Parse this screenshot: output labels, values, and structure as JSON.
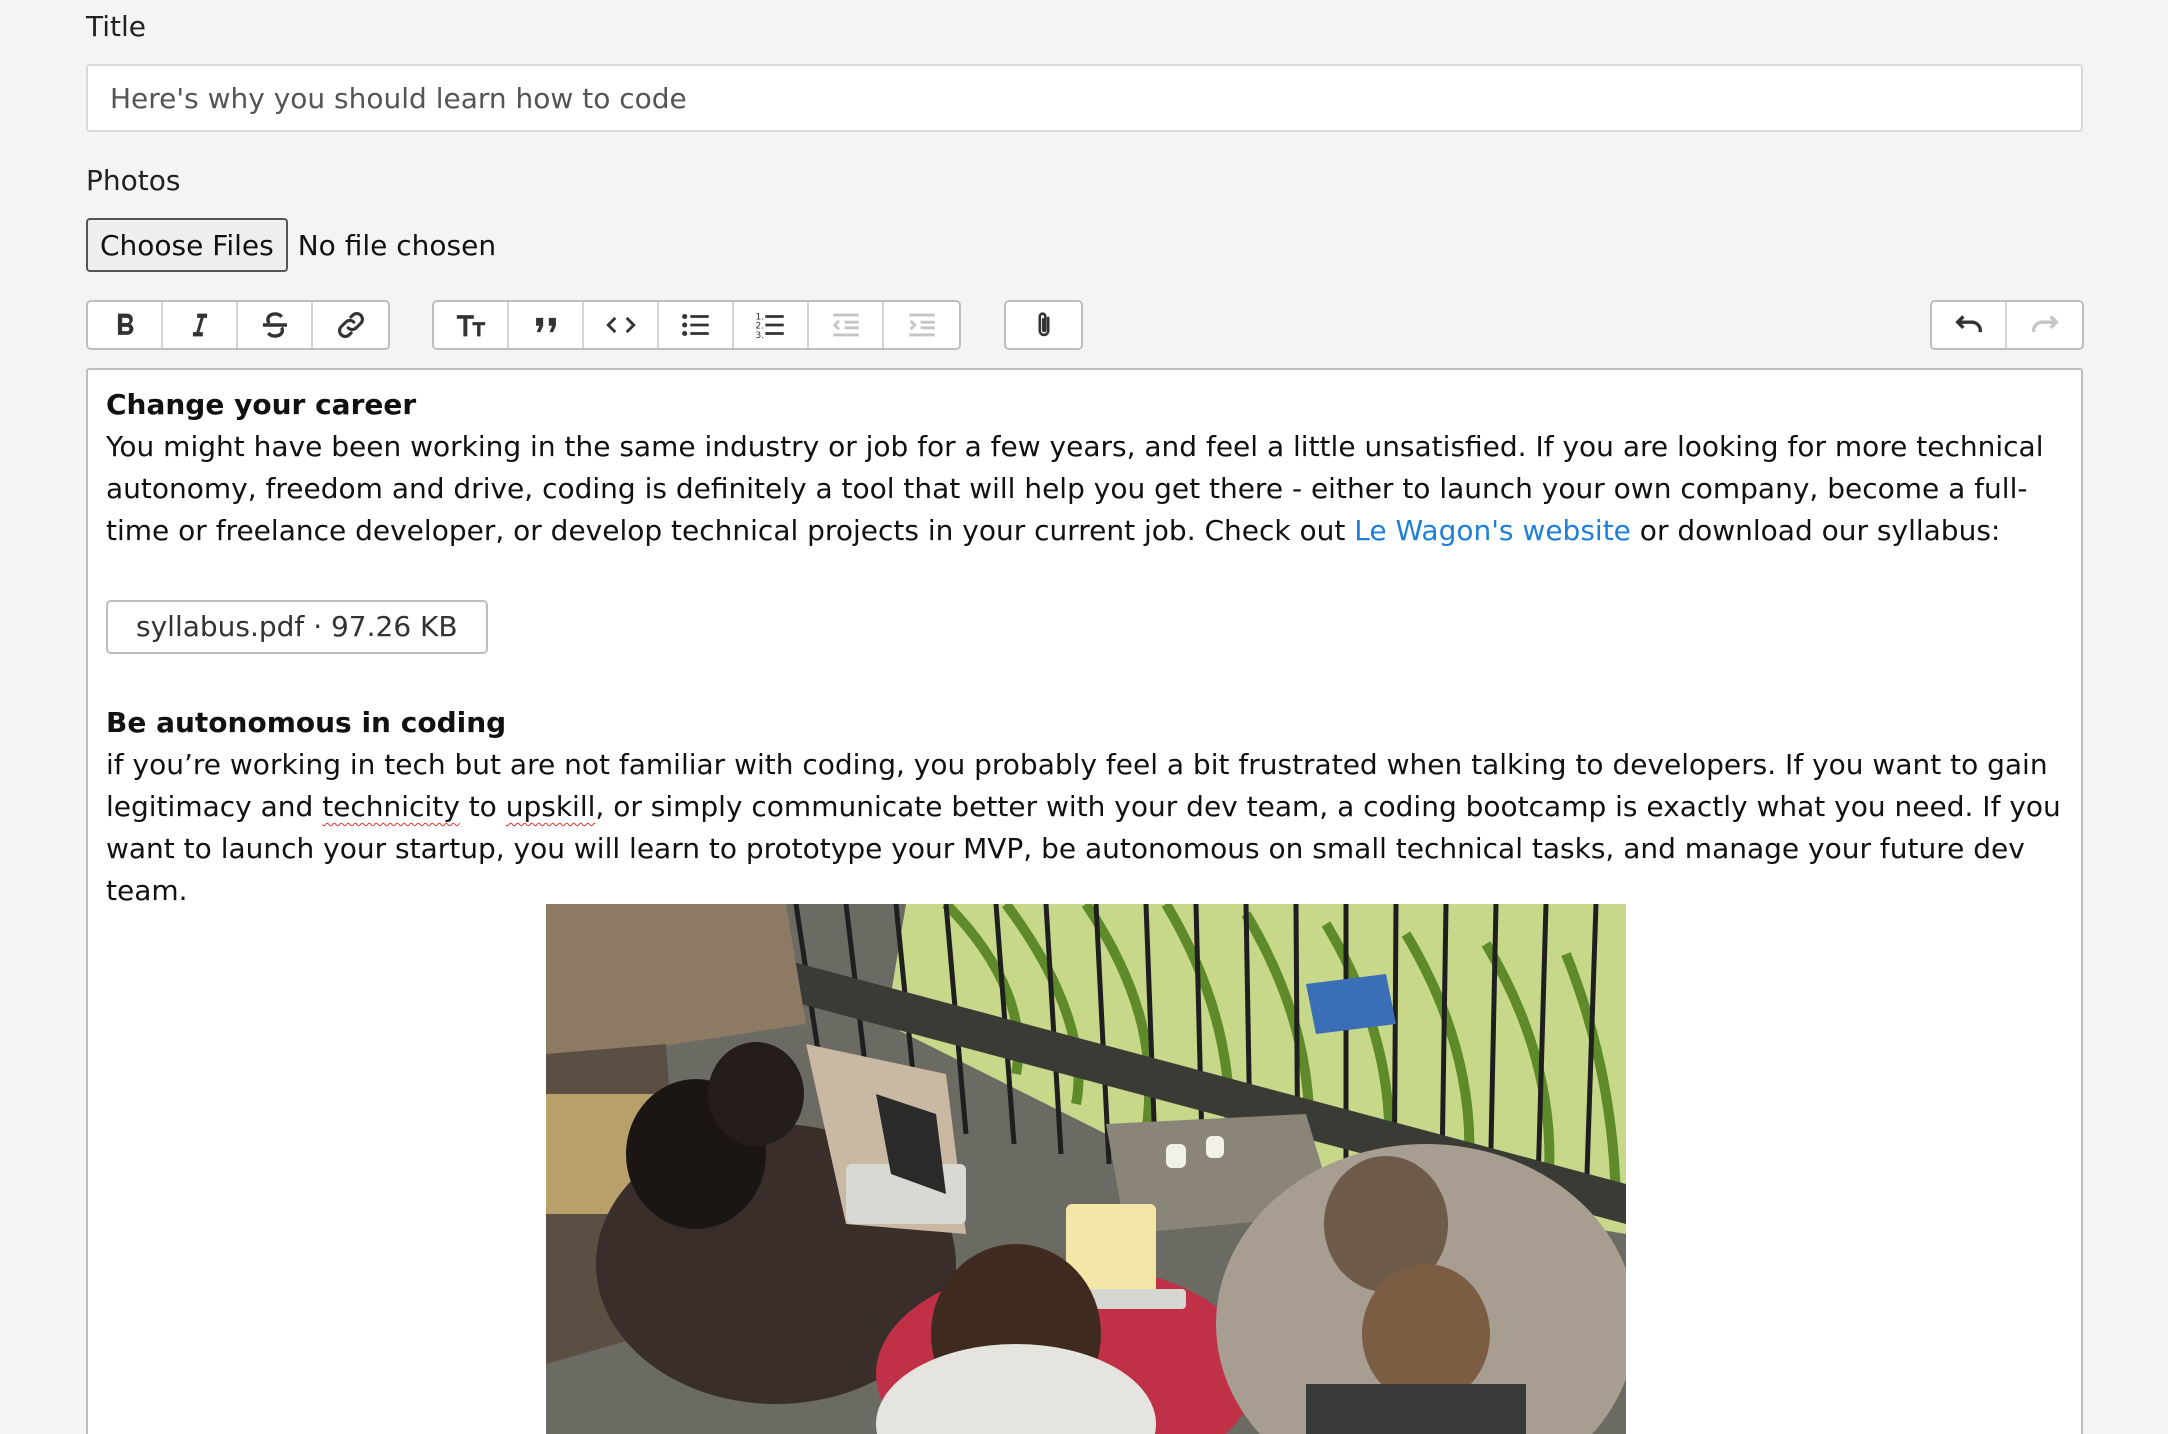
{
  "form": {
    "title_label": "Title",
    "title_value": "Here's why you should learn how to code",
    "photos_label": "Photos",
    "choose_files_label": "Choose Files",
    "no_file_text": "No file chosen"
  },
  "toolbar": {
    "text_tools": [
      "bold-icon",
      "italic-icon",
      "strikethrough-icon",
      "link-icon"
    ],
    "block_tools": [
      "heading-icon",
      "quote-icon",
      "code-icon",
      "bullet-list-icon",
      "numbered-list-icon",
      "decrease-indent-icon",
      "increase-indent-icon"
    ],
    "file_tools": [
      "attach-icon"
    ],
    "history_tools": [
      "undo-icon",
      "redo-icon"
    ]
  },
  "editor": {
    "section1_heading": "Change your career",
    "section1_text_before_link": "You might have been working in the same industry or job for a few years, and feel a little unsatisfied. If you are looking for more technical autonomy, freedom and drive, coding is definitely a tool that will help you get there - either to launch your own company, become a full-time or freelance developer, or develop technical projects in your current job. Check out ",
    "section1_link": "Le Wagon's website",
    "section1_text_after_link": " or download our syllabus:",
    "attachment_label": "syllabus.pdf · 97.26 KB",
    "section2_heading": "Be autonomous in coding",
    "section2_text_part1": "if you’re working in tech but are not familiar with coding, you probably feel a bit frustrated when talking to developers. If you want to gain legitimacy and ",
    "section2_word_technicity": "technicity",
    "section2_text_part2": " to ",
    "section2_word_upskill": "upskill",
    "section2_text_part3": ", or simply communicate better with your dev team, a coding bootcamp is exactly what you need. If you want to launch your startup, you will learn to prototype your MVP, be autonomous on small technical tasks, and manage your future dev team."
  },
  "colors": {
    "link": "#1e7fd8",
    "background": "#f4f4f4",
    "border": "#bdbdbd"
  }
}
